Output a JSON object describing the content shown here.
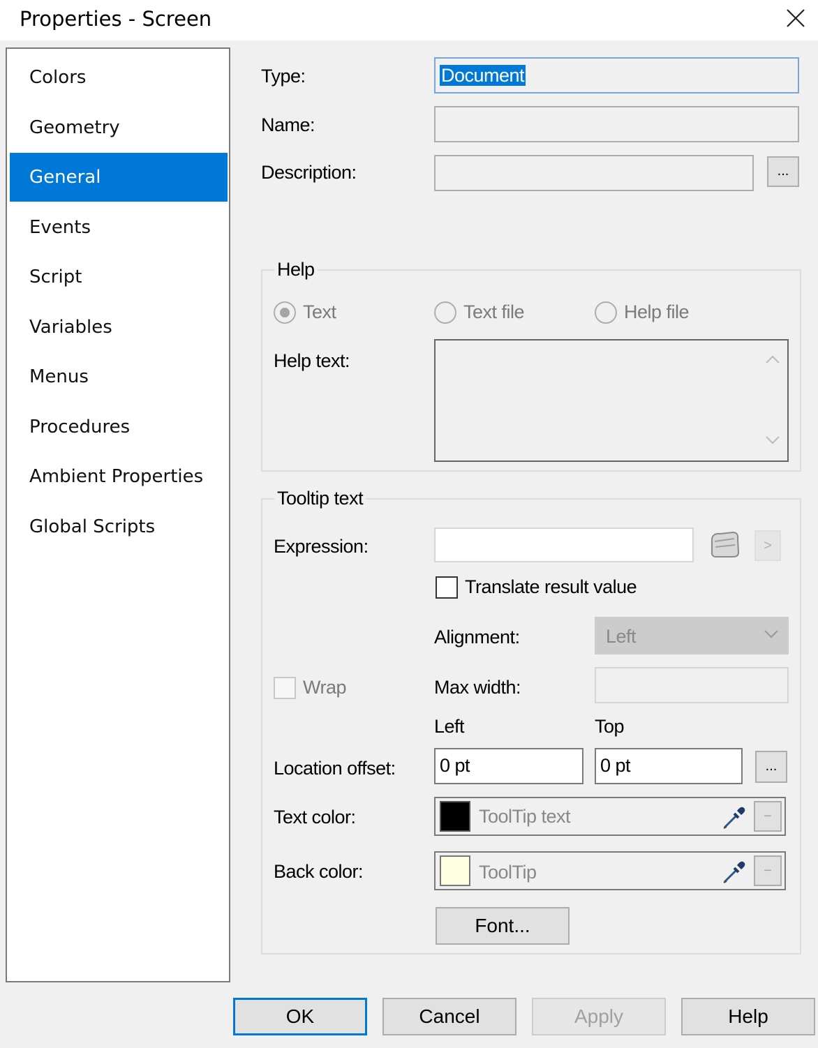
{
  "window": {
    "title": "Properties - Screen",
    "close_icon": "close-icon"
  },
  "nav": {
    "items": [
      {
        "label": "Colors"
      },
      {
        "label": "Geometry"
      },
      {
        "label": "General",
        "selected": true
      },
      {
        "label": "Events"
      },
      {
        "label": "Script"
      },
      {
        "label": "Variables"
      },
      {
        "label": "Menus"
      },
      {
        "label": "Procedures"
      },
      {
        "label": "Ambient Properties"
      },
      {
        "label": "Global Scripts"
      }
    ]
  },
  "general": {
    "type_label": "Type:",
    "type_value": "Document",
    "name_label": "Name:",
    "name_value": "",
    "description_label": "Description:",
    "description_value": "",
    "ellipsis": "..."
  },
  "help": {
    "legend": "Help",
    "radio_text": "Text",
    "radio_text_file": "Text file",
    "radio_help_file": "Help file",
    "selected": "Text",
    "help_text_label": "Help text:",
    "help_text_value": ""
  },
  "tooltip": {
    "legend": "Tooltip text",
    "expression_label": "Expression:",
    "expression_value": "",
    "next_label": ">",
    "translate_label": "Translate result value",
    "translate_checked": false,
    "alignment_label": "Alignment:",
    "alignment_value": "Left",
    "wrap_label": "Wrap",
    "wrap_checked": false,
    "max_width_label": "Max width:",
    "max_width_value": "",
    "left_label": "Left",
    "top_label": "Top",
    "location_offset_label": "Location offset:",
    "left_value": "0 pt",
    "top_value": "0 pt",
    "ellipsis": "...",
    "text_color_label": "Text color:",
    "text_color_name": "ToolTip text",
    "text_color_hex": "#000000",
    "back_color_label": "Back color:",
    "back_color_name": "ToolTip",
    "back_color_hex": "#ffffe1",
    "minus_label": "−",
    "font_button": "Font..."
  },
  "buttons": {
    "ok": "OK",
    "cancel": "Cancel",
    "apply": "Apply",
    "help": "Help"
  },
  "colors": {
    "accent": "#0078d7",
    "window_bg": "#f0f0f0",
    "disabled_text": "#7a7a7a"
  }
}
